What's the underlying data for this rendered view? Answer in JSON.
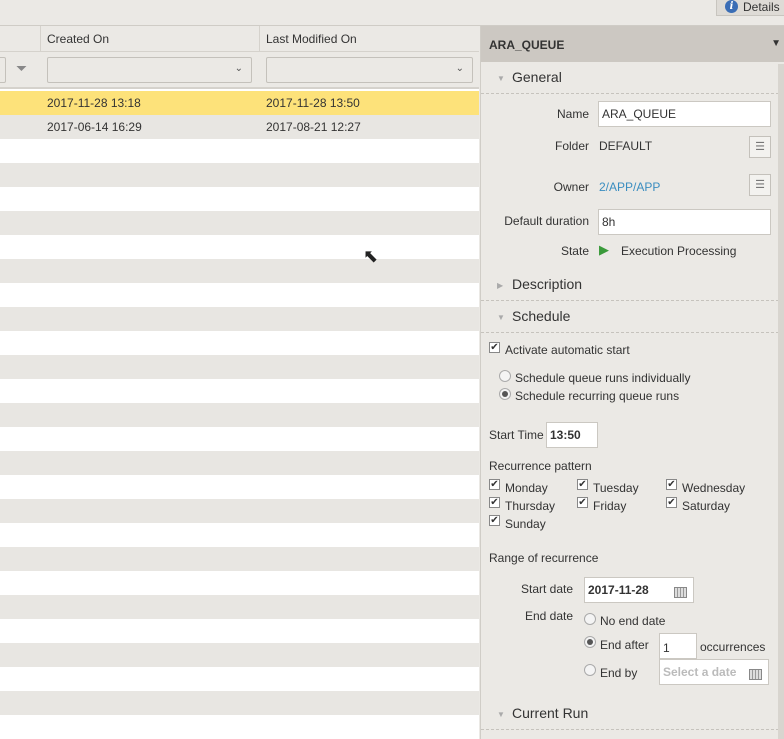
{
  "toolbar": {
    "details_label": "Details"
  },
  "grid": {
    "columns": [
      "Created On",
      "Last Modified On"
    ],
    "rows": [
      {
        "created": "2017-11-28 13:18",
        "modified": "2017-11-28 13:50",
        "selected": true
      },
      {
        "created": "2017-06-14 16:29",
        "modified": "2017-08-21 12:27",
        "selected": false
      }
    ]
  },
  "panel": {
    "title": "ARA_QUEUE",
    "general": {
      "title": "General",
      "name_label": "Name",
      "name": "ARA_QUEUE",
      "folder_label": "Folder",
      "folder": "DEFAULT",
      "owner_label": "Owner",
      "owner": "2/APP/APP",
      "duration_label": "Default duration",
      "duration": "8h",
      "state_label": "State",
      "state": "Execution Processing"
    },
    "description": {
      "title": "Description"
    },
    "schedule": {
      "title": "Schedule",
      "activate": "Activate automatic start",
      "opt_individual": "Schedule queue runs individually",
      "opt_recurring": "Schedule recurring queue runs",
      "start_time_label": "Start Time",
      "start_time": "13:50",
      "pattern_label": "Recurrence pattern",
      "days": [
        "Monday",
        "Tuesday",
        "Wednesday",
        "Thursday",
        "Friday",
        "Saturday",
        "Sunday"
      ],
      "range_label": "Range of recurrence",
      "start_date_label": "Start date",
      "start_date": "2017-11-28",
      "end_date_label": "End date",
      "no_end": "No end date",
      "end_after": "End after",
      "occurrences_value": "1",
      "occurrences": "occurrences",
      "end_by": "End by",
      "date_placeholder": "Select a date"
    },
    "current_run": {
      "title": "Current Run"
    }
  },
  "colors": {
    "selected_row": "#fde27a",
    "stripe": "#e8e6e2",
    "link": "#3a8dc0"
  }
}
